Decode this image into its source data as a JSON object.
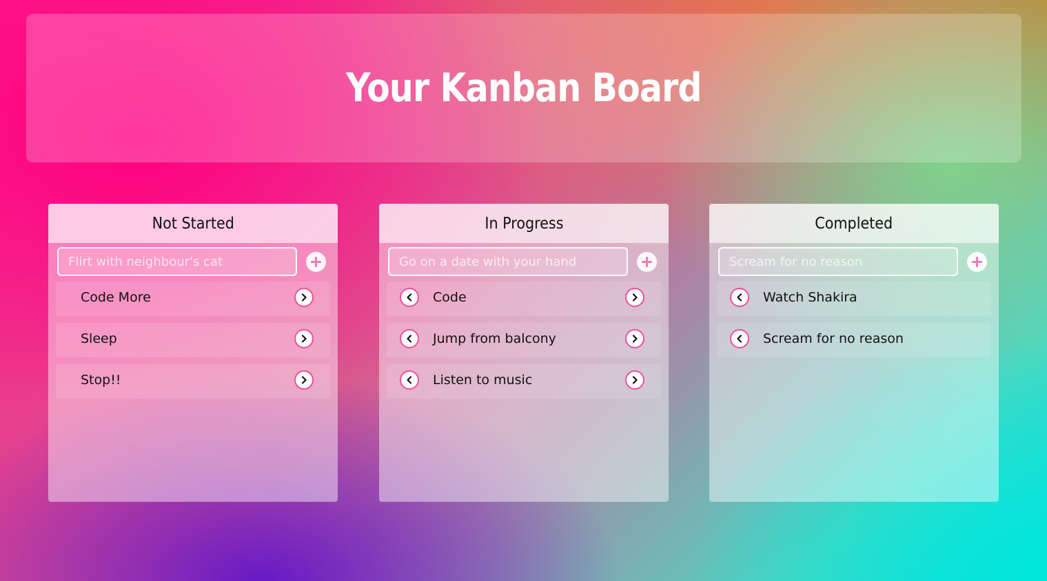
{
  "header": {
    "title": "Your Kanban Board"
  },
  "columns": [
    {
      "title": "Not Started",
      "input_placeholder": "Flirt with neighbour's cat",
      "tasks": [
        "Code More",
        "Sleep",
        "Stop!!"
      ]
    },
    {
      "title": "In Progress",
      "input_placeholder": "Go on a date with your hand",
      "tasks": [
        "Code",
        "Jump from balcony",
        "Listen to music"
      ]
    },
    {
      "title": "Completed",
      "input_placeholder": "Scream for no reason",
      "tasks": [
        "Watch Shakira",
        "Scream for no reason"
      ]
    }
  ],
  "icons": {
    "add": "plus-icon",
    "move_left": "chevron-left-icon",
    "move_right": "chevron-right-icon"
  },
  "colors": {
    "accent": "#ef4f9b",
    "header_text": "#ffffff"
  }
}
